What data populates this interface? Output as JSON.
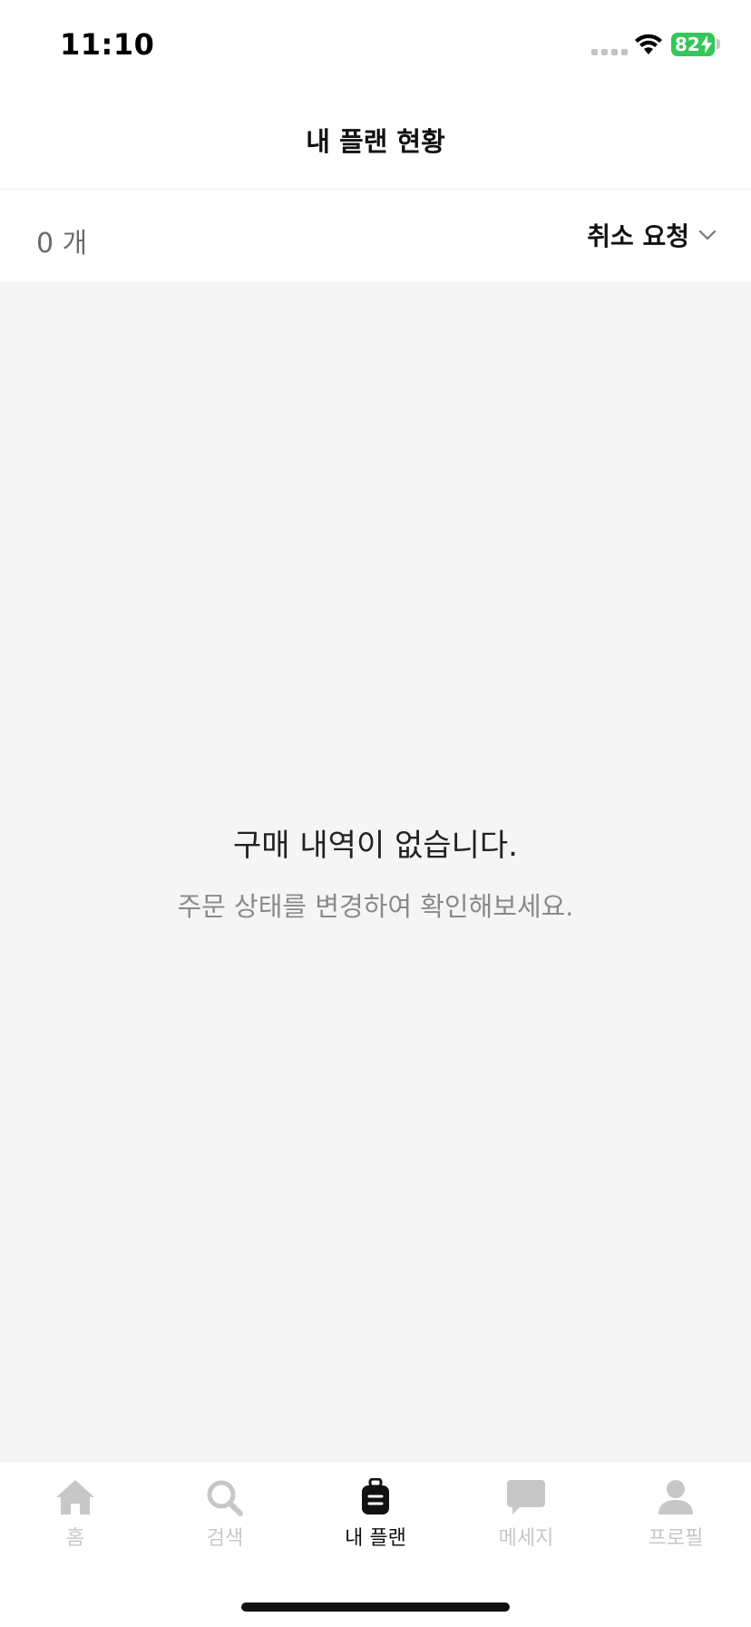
{
  "status_bar": {
    "time": "11:10",
    "battery": "82"
  },
  "header": {
    "title": "내 플랜 현황"
  },
  "filter_bar": {
    "count": "0 개",
    "filter_label": "취소 요청",
    "filter_icon": "chevron-down-icon"
  },
  "empty_state": {
    "title": "구매 내역이 없습니다.",
    "subtitle": "주문 상태를 변경하여 확인해보세요."
  },
  "tab_bar": {
    "tabs": [
      {
        "label": "홈",
        "icon": "home-icon",
        "active": false
      },
      {
        "label": "검색",
        "icon": "search-icon",
        "active": false
      },
      {
        "label": "내 플랜",
        "icon": "suitcase-icon",
        "active": true
      },
      {
        "label": "메세지",
        "icon": "message-icon",
        "active": false
      },
      {
        "label": "프로필",
        "icon": "profile-icon",
        "active": false
      }
    ]
  },
  "colors": {
    "active": "#111111",
    "inactive": "#c7c7c7",
    "battery": "#34c759",
    "background": "#f5f5f5"
  }
}
